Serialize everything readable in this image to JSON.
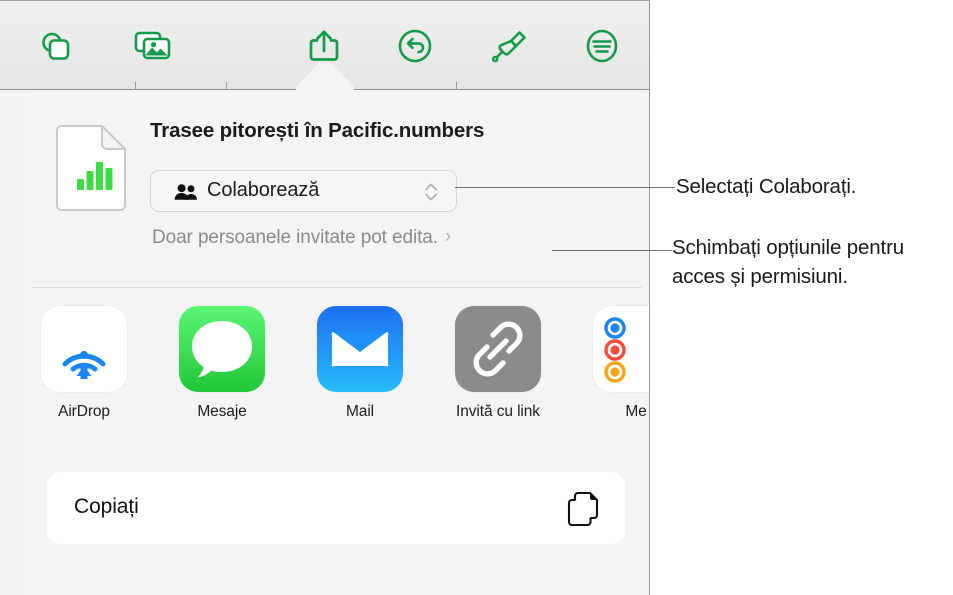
{
  "app": {
    "name": "Numbers",
    "toolbar": {
      "items": [
        {
          "name": "insert-object-icon",
          "label": "Insert object"
        },
        {
          "name": "media-icon",
          "label": "Media"
        },
        {
          "name": "share-icon",
          "label": "Share"
        },
        {
          "name": "undo-icon",
          "label": "Undo"
        },
        {
          "name": "format-brush-icon",
          "label": "Format"
        },
        {
          "name": "document-options-icon",
          "label": "Document options"
        }
      ],
      "accent_color": "#159a4d"
    }
  },
  "popover": {
    "document": {
      "icon": "numbers-document-icon",
      "title": "Trasee pitorești în Pacific.numbers"
    },
    "collaborate": {
      "icon": "people-icon",
      "label": "Colaborează",
      "chevrons_icon": "chevron-up-down-icon"
    },
    "permissions": {
      "text": "Doar persoanele invitate pot edita.",
      "chevron": "›"
    },
    "share_targets": [
      {
        "label": "AirDrop",
        "icon": "airdrop-icon",
        "tile": "tile-airdrop"
      },
      {
        "label": "Mesaje",
        "icon": "messages-icon",
        "tile": "tile-messages"
      },
      {
        "label": "Mail",
        "icon": "mail-icon",
        "tile": "tile-mail"
      },
      {
        "label": "Invită cu link",
        "icon": "link-icon",
        "tile": "tile-link"
      },
      {
        "label": "Me",
        "icon": "reminders-icon",
        "tile": "tile-reminders"
      }
    ],
    "actions": [
      {
        "label": "Copiați",
        "icon": "copy-icon"
      }
    ]
  },
  "callouts": [
    {
      "id": "callout-1",
      "text": "Selectați Colaborați."
    },
    {
      "id": "callout-2",
      "text": "Schimbați opțiunile pentru acces și permisiuni."
    }
  ],
  "colors": {
    "toolbar_green": "#159a4d",
    "airdrop_blue": "#1b86f0",
    "messages_green": "#30c94a",
    "mail_blue": "#1e8ff5",
    "link_gray": "#8b8b8e",
    "reminder_blue": "#1b86f0",
    "reminder_red": "#f64c3c",
    "reminder_orange": "#f7a51b",
    "numbers_green": "#3ddc45"
  }
}
